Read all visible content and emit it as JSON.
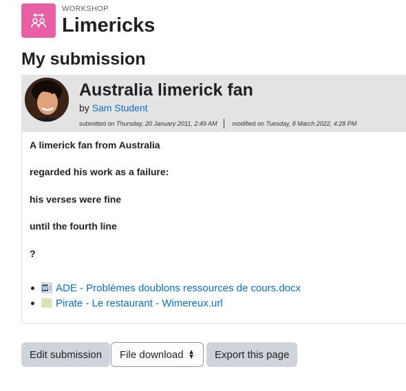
{
  "activity": {
    "kind": "WORKSHOP",
    "title": "Limericks",
    "icon": "workshop-people-icon",
    "icon_color": "#e95fa6"
  },
  "section_heading": "My submission",
  "submission": {
    "title": "Australia limerick fan",
    "by_prefix": "by",
    "author": "Sam Student",
    "submitted_label": "submitted on",
    "submitted_date": "Thursday, 20 January 2011, 2:49 AM",
    "modified_label": "modified on",
    "modified_date": "Tuesday, 8 March 2022, 4:28 PM",
    "lines": [
      "A limerick fan from Australia",
      "regarded his work as a failure:",
      "his verses were fine",
      "until the fourth line",
      "?"
    ],
    "attachments": [
      {
        "name": "ADE - Problèmes doublons ressources de cours.docx",
        "icon": "word-document-icon"
      },
      {
        "name": "Pirate - Le restaurant - Wimereux.url",
        "icon": "url-file-icon"
      }
    ]
  },
  "actions": {
    "edit_label": "Edit submission",
    "download_selected": "File download",
    "export_label": "Export this page"
  },
  "colors": {
    "link": "#0f6cbf",
    "header_bg": "#e3e3e3",
    "button_bg": "#ced4da"
  }
}
